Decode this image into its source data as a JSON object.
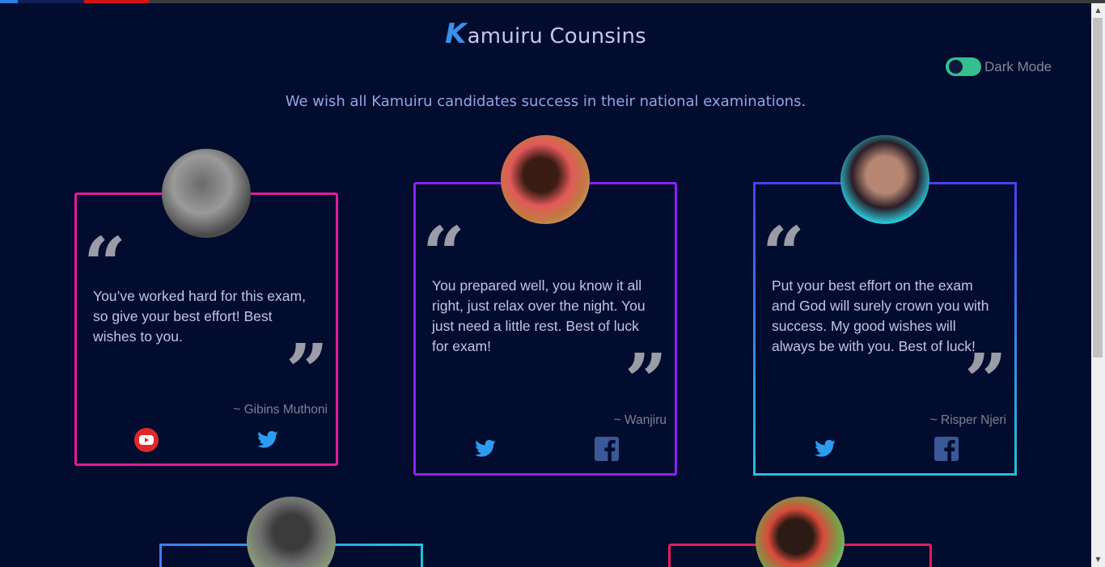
{
  "header": {
    "brand_initial": "K",
    "brand_rest": "amuiru Counsins",
    "dark_mode_label": "Dark Mode",
    "subtitle": "We wish all Kamuiru candidates success in their national examinations."
  },
  "colors": {
    "background": "#020c2e",
    "brand_accent": "#3b8fe8",
    "toggle_on": "#34c08e",
    "twitter": "#2d9cf0",
    "youtube": "#e0282a",
    "facebook": "#3b5998"
  },
  "cards": [
    {
      "quote": "You’ve worked hard for this exam, so give your best effort! Best wishes to you.",
      "author": "~ Gibins Muthoni",
      "icons": [
        "youtube-icon",
        "twitter-icon"
      ]
    },
    {
      "quote": "You prepared well, you know it all right, just relax over the night. You just need a little rest. Best of luck for exam!",
      "author": "~ Wanjiru",
      "icons": [
        "twitter-icon",
        "facebook-icon"
      ]
    },
    {
      "quote": "Put your best effort on the exam and God will surely crown you with success. My good wishes will always be with you. Best of luck!",
      "author": "~ Risper Njeri",
      "icons": [
        "twitter-icon",
        "facebook-icon"
      ]
    }
  ],
  "quote_marks": {
    "open": "“",
    "close": "”"
  }
}
